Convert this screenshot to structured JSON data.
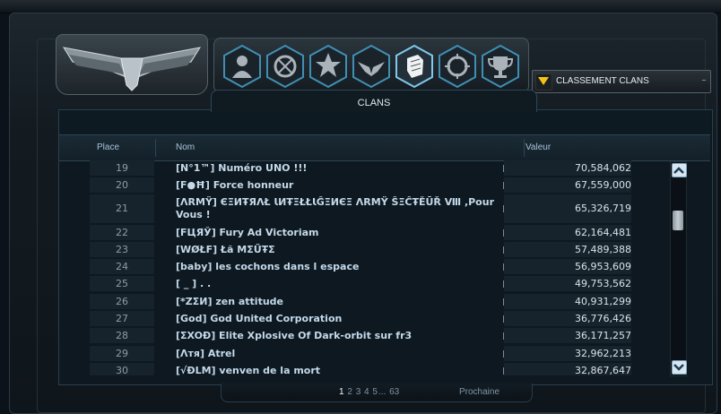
{
  "emblem": {
    "icon": "winged-emblem-icon"
  },
  "nav_icons": [
    "user-icon",
    "clan-crest-icon",
    "rank-medal-icon",
    "wings-icon",
    "glove-icon",
    "target-icon",
    "trophy-icon"
  ],
  "dropdown": {
    "label": "CLASSEMENT CLANS",
    "icon": "chevron-down-icon"
  },
  "panel": {
    "title": "CLANS"
  },
  "columns": {
    "place": "Place",
    "name": "Nom",
    "value": "Valeur"
  },
  "rows": [
    {
      "place": "19",
      "name": "[N°1™] Numéro UNO !!!",
      "value": "70,584,062"
    },
    {
      "place": "20",
      "name": "[F●Ħ] Force honneur",
      "value": "67,559,000"
    },
    {
      "place": "21",
      "name": "[ΛRMŸ] ЄΞИŦЯΛŁ ƖИŦΞŁŁƖĜΞИЄΞ ΛRMŸ ŜΞĈŦĔŪŘ Ⅷ ,Pour Vous !",
      "value": "65,326,719"
    },
    {
      "place": "22",
      "name": "[FЦЯЎ] Fury Ad Victoriam",
      "value": "62,164,481"
    },
    {
      "place": "23",
      "name": "[WØŁF] Łã MΣŰŦΣ",
      "value": "57,489,388"
    },
    {
      "place": "24",
      "name": "[baby] les cochons dans l espace",
      "value": "56,953,609"
    },
    {
      "place": "25",
      "name": "[ _ ] .          .",
      "value": "49,753,562"
    },
    {
      "place": "26",
      "name": "[*ZΣИ] zen attitude",
      "value": "40,931,299"
    },
    {
      "place": "27",
      "name": "[God] God United Corporation",
      "value": "36,776,426"
    },
    {
      "place": "28",
      "name": "[ΣXOÐ] Elite Xplosive Of Dark-orbit sur fr3",
      "value": "36,171,257"
    },
    {
      "place": "29",
      "name": "[Λтя] Atrel",
      "value": "32,962,213"
    },
    {
      "place": "30",
      "name": "[√ÐLM] venven de la mort",
      "value": "32,867,647"
    }
  ],
  "pagination": {
    "pages": [
      "1",
      "2",
      "3",
      "4",
      "5"
    ],
    "ellipsis": "...",
    "last": "63",
    "current": "1",
    "next": "Prochaine"
  }
}
